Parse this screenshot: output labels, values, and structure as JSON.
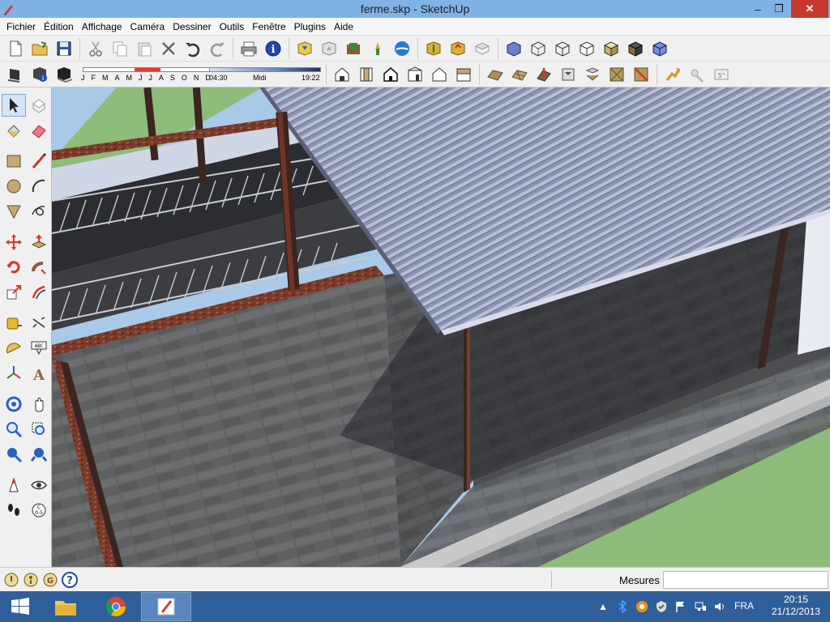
{
  "window": {
    "title": "ferme.skp - SketchUp",
    "minimize_glyph": "–",
    "maximize_glyph": "❐",
    "close_glyph": "✕"
  },
  "menu": [
    {
      "label": "Fichier"
    },
    {
      "label": "Édition"
    },
    {
      "label": "Affichage"
    },
    {
      "label": "Caméra"
    },
    {
      "label": "Dessiner"
    },
    {
      "label": "Outils"
    },
    {
      "label": "Fenêtre"
    },
    {
      "label": "Plugins"
    },
    {
      "label": "Aide"
    }
  ],
  "toolbar1_icons": [
    "new-icon",
    "open-icon",
    "save-icon",
    "cut-icon",
    "copy-icon",
    "paste-icon",
    "erase-icon",
    "undo-icon",
    "redo-icon",
    "print-icon",
    "model-info-icon",
    "get-models-icon",
    "share-model-icon",
    "add-location-icon",
    "toggle-terrain-icon",
    "google-earth-icon",
    "get-components-icon",
    "share-component-icon",
    "extension-icon",
    "xray-icon",
    "back-edges-icon",
    "wireframe-icon",
    "hidden-line-icon",
    "shaded-icon",
    "shaded-textures-icon",
    "monochrome-icon"
  ],
  "toolbar2_icons": [
    "shadows-toggle-icon",
    "shadow-settings-icon",
    "display-shadows-icon",
    "iso-view-icon",
    "top-view-icon",
    "front-view-icon",
    "right-view-icon",
    "back-view-icon",
    "left-view-icon",
    "sandbox-from-contours-icon",
    "sandbox-from-scratch-icon",
    "smoove-icon",
    "stamp-icon",
    "drape-icon",
    "add-detail-icon",
    "flip-edge-icon",
    "solid-tools-icon",
    "outer-shell-icon",
    "intersect-icon"
  ],
  "shadow": {
    "months": [
      "J",
      "F",
      "M",
      "A",
      "M",
      "J",
      "J",
      "A",
      "S",
      "O",
      "N",
      "D"
    ],
    "time_start": "04:30",
    "time_noon": "Midi",
    "time_end": "19:22"
  },
  "left_tools": [
    "select-icon",
    "make-component-icon",
    "paint-bucket-icon",
    "eraser-icon",
    "rectangle-icon",
    "line-icon",
    "circle-icon",
    "arc-icon",
    "polygon-icon",
    "freehand-icon",
    "move-icon",
    "push-pull-icon",
    "rotate-icon",
    "follow-me-icon",
    "scale-icon",
    "offset-icon",
    "tape-measure-icon",
    "dimension-icon",
    "protractor-icon",
    "text-icon",
    "axes-icon",
    "3d-text-icon",
    "orbit-icon",
    "pan-icon",
    "zoom-icon",
    "zoom-window-icon",
    "zoom-extents-icon",
    "previous-view-icon",
    "position-camera-icon",
    "look-around-icon",
    "walk-icon",
    "section-plane-icon"
  ],
  "status": {
    "measure_label": "Mesures",
    "measure_value": ""
  },
  "taskbar": {
    "language": "FRA",
    "time": "20:15",
    "date": "21/12/2013"
  },
  "colors": {
    "sky": "#a9c9e8",
    "grass": "#8ebc7a",
    "roof": "#8c93b0",
    "wall": "#5e5f60",
    "beam": "#7a3b2a",
    "taskbar": "#2f5f9a",
    "titlebar": "#7fb2e5"
  }
}
